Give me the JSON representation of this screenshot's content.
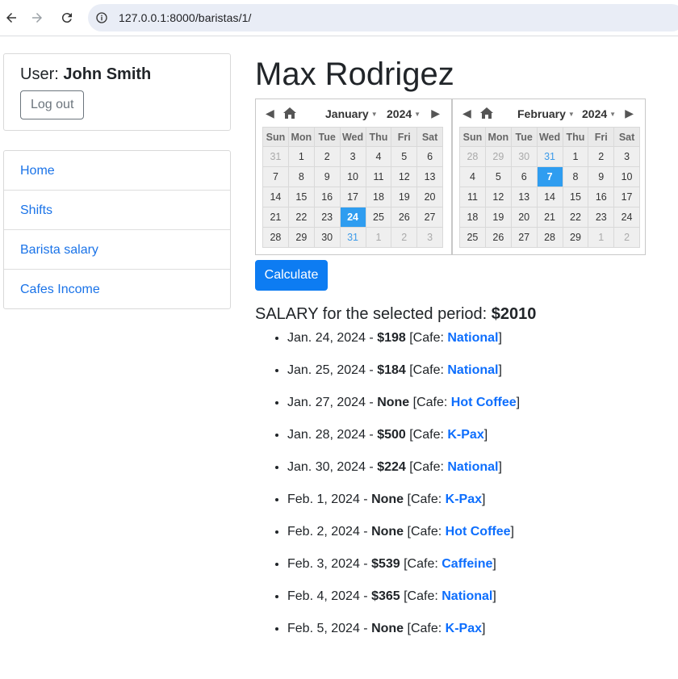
{
  "browser": {
    "url": "127.0.0.1:8000/baristas/1/"
  },
  "user_card": {
    "prefix": "User:",
    "name": "John Smith",
    "logout_label": "Log out"
  },
  "menu": {
    "items": [
      {
        "label": "Home"
      },
      {
        "label": "Shifts"
      },
      {
        "label": "Barista salary"
      },
      {
        "label": "Cafes Income"
      }
    ]
  },
  "page_title": "Max Rodrigez",
  "calendars": {
    "weekdays": [
      "Sun",
      "Mon",
      "Tue",
      "Wed",
      "Thu",
      "Fri",
      "Sat"
    ],
    "left": {
      "month": "January",
      "year": "2024",
      "days": [
        [
          "31",
          "1",
          "2",
          "3",
          "4",
          "5",
          "6"
        ],
        [
          "7",
          "8",
          "9",
          "10",
          "11",
          "12",
          "13"
        ],
        [
          "14",
          "15",
          "16",
          "17",
          "18",
          "19",
          "20"
        ],
        [
          "21",
          "22",
          "23",
          "24",
          "25",
          "26",
          "27"
        ],
        [
          "28",
          "29",
          "30",
          "31",
          "1",
          "2",
          "3"
        ]
      ],
      "selected_day": "24"
    },
    "right": {
      "month": "February",
      "year": "2024",
      "days": [
        [
          "28",
          "29",
          "30",
          "31",
          "1",
          "2",
          "3"
        ],
        [
          "4",
          "5",
          "6",
          "7",
          "8",
          "9",
          "10"
        ],
        [
          "11",
          "12",
          "13",
          "14",
          "15",
          "16",
          "17"
        ],
        [
          "18",
          "19",
          "20",
          "21",
          "22",
          "23",
          "24"
        ],
        [
          "25",
          "26",
          "27",
          "28",
          "29",
          "1",
          "2"
        ]
      ],
      "selected_day": "7"
    }
  },
  "calculate_label": "Calculate",
  "salary": {
    "label": "SALARY for the selected period:",
    "total": "$2010"
  },
  "shifts": [
    {
      "date": "Jan. 24, 2024",
      "amount": "$198",
      "cafe": "National"
    },
    {
      "date": "Jan. 25, 2024",
      "amount": "$184",
      "cafe": "National"
    },
    {
      "date": "Jan. 27, 2024",
      "amount": "None",
      "cafe": "Hot Coffee"
    },
    {
      "date": "Jan. 28, 2024",
      "amount": "$500",
      "cafe": "K-Pax"
    },
    {
      "date": "Jan. 30, 2024",
      "amount": "$224",
      "cafe": "National"
    },
    {
      "date": "Feb. 1, 2024",
      "amount": "None",
      "cafe": "K-Pax"
    },
    {
      "date": "Feb. 2, 2024",
      "amount": "None",
      "cafe": "Hot Coffee"
    },
    {
      "date": "Feb. 3, 2024",
      "amount": "$539",
      "cafe": "Caffeine"
    },
    {
      "date": "Feb. 4, 2024",
      "amount": "$365",
      "cafe": "National"
    },
    {
      "date": "Feb. 5, 2024",
      "amount": "None",
      "cafe": "K-Pax"
    }
  ],
  "shift_text": {
    "separator": " - ",
    "cafe_prefix": " [Cafe: ",
    "cafe_suffix": "]"
  },
  "colors": {
    "primary": "#0d7cf2",
    "link": "#0d6efd",
    "selected_day": "#2f9df0"
  }
}
